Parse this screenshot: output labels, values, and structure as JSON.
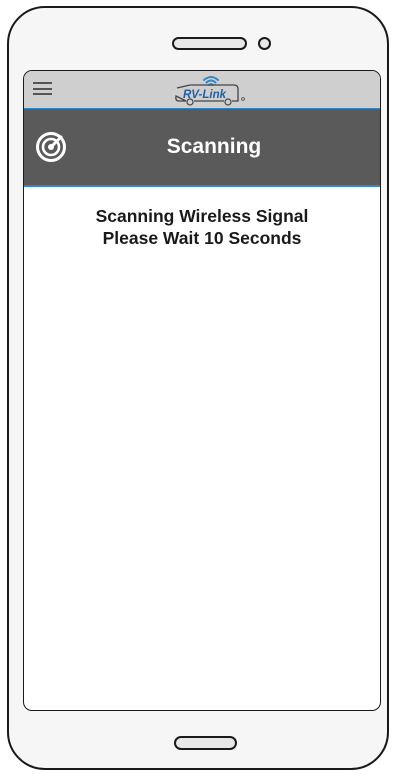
{
  "app": {
    "logo_text": "RV-Link"
  },
  "header": {
    "title": "Scanning",
    "title_icon": "radar-icon",
    "menu_icon": "hamburger-menu-icon"
  },
  "main": {
    "message_line1": "Scanning Wireless Signal",
    "message_line2_prefix": "Please Wait",
    "countdown_seconds": "10",
    "message_line2_suffix": "Seconds"
  },
  "colors": {
    "app_bar": "#cfcfcf",
    "title_bar": "#5a5a5a",
    "accent_blue": "#2f86c8",
    "logo_blue": "#1f5fa8"
  }
}
